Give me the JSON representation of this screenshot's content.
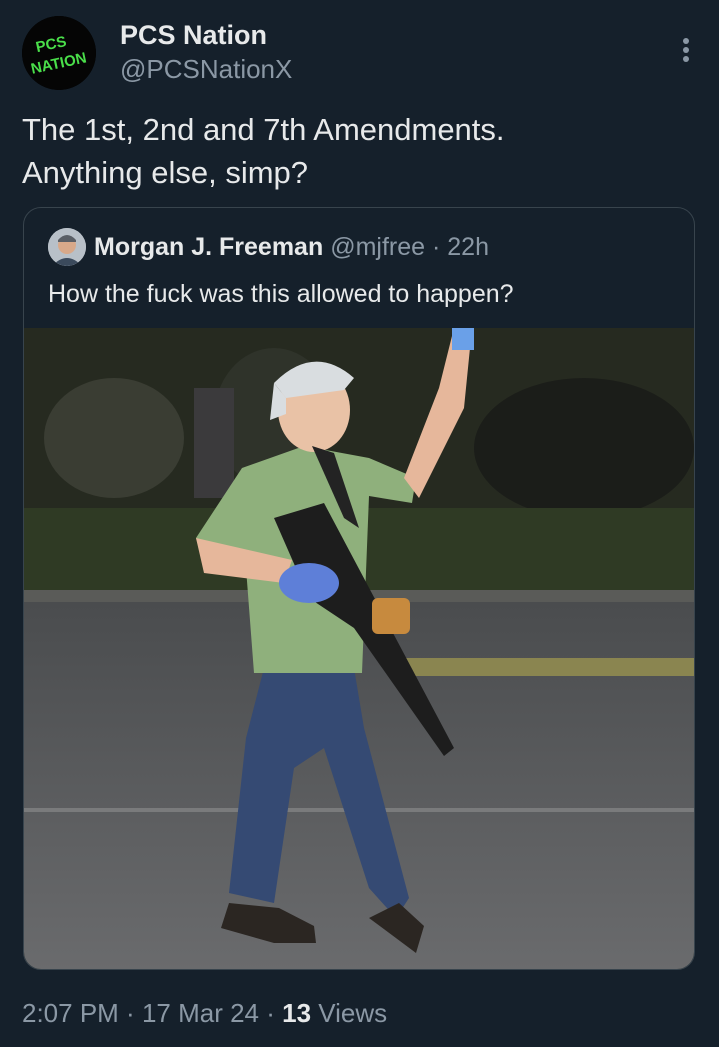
{
  "author": {
    "name": "PCS Nation",
    "handle": "@PCSNationX",
    "avatar_text": [
      "PCS",
      "NATION"
    ],
    "avatar_color": "#4ade4a"
  },
  "more_icon": "more-vertical-icon",
  "tweet": {
    "text": "The 1st, 2nd and 7th Amendments.\nAnything else, simp?"
  },
  "quoted": {
    "name": "Morgan J. Freeman",
    "handle": "@mjfree",
    "separator": "·",
    "time": "22h",
    "text": "How the fuck was this allowed to happen?",
    "media": "photo of a young man in a green t-shirt and backwards cap carrying a rifle on a street at night"
  },
  "footer": {
    "time": "2:07 PM",
    "sep1": " · ",
    "date": "17 Mar 24",
    "sep2": " · ",
    "views_count": "13",
    "views_label": " Views"
  },
  "colors": {
    "background": "#15202b",
    "text": "#e7e9ea",
    "secondary": "#8b98a5",
    "border": "#38444d"
  }
}
